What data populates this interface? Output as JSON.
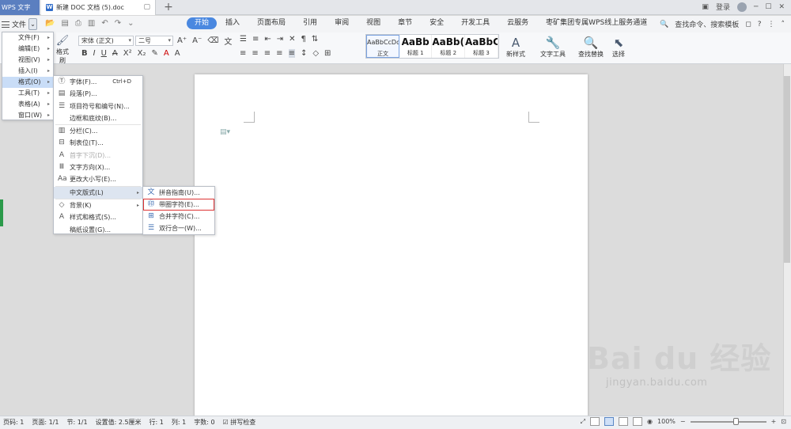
{
  "titlebar": {
    "app_tab": "WPS 文字",
    "doc_tab": "新建 DOC 文档 (5).doc",
    "login": "登录"
  },
  "menubar": {
    "file": "文件",
    "tabs": [
      "开始",
      "插入",
      "页面布局",
      "引用",
      "审阅",
      "视图",
      "章节",
      "安全",
      "开发工具",
      "云服务",
      "枣矿集团专属WPS线上服务通道"
    ],
    "active_tab": "开始",
    "search": "查找命令、搜索模板"
  },
  "ribbon": {
    "format_painter": "格式刷",
    "font_name": "宋体 (正文)",
    "font_size": "二号",
    "styles": [
      {
        "preview": "AaBbCcDd",
        "label": "正文"
      },
      {
        "preview": "AaBb",
        "label": "标题 1"
      },
      {
        "preview": "AaBb(",
        "label": "标题 2"
      },
      {
        "preview": "AaBbC(",
        "label": "标题 3"
      }
    ],
    "new_style": "新样式",
    "text_tools": "文字工具",
    "find_replace": "查找替换",
    "select": "选择"
  },
  "file_menu": {
    "items": [
      "文件(F)",
      "编辑(E)",
      "视图(V)",
      "插入(I)",
      "格式(O)",
      "工具(T)",
      "表格(A)",
      "窗口(W)"
    ],
    "highlighted_index": 4
  },
  "format_menu": {
    "items": [
      {
        "label": "字体(F)...",
        "shortcut": "Ctrl+D",
        "icon": "font-icon"
      },
      {
        "label": "段落(P)...",
        "icon": "paragraph-icon"
      },
      {
        "label": "项目符号和编号(N)...",
        "icon": "bullets-icon"
      },
      {
        "label": "边框和底纹(B)...",
        "icon": ""
      },
      {
        "label": "分栏(C)...",
        "icon": "columns-icon"
      },
      {
        "label": "制表位(T)...",
        "icon": "tabstop-icon"
      },
      {
        "label": "首字下沉(D)...",
        "icon": "dropcap-icon",
        "disabled": true
      },
      {
        "label": "文字方向(X)...",
        "icon": "text-direction-icon"
      },
      {
        "label": "更改大小写(E)...",
        "icon": "change-case-icon"
      },
      {
        "label": "中文版式(L)",
        "icon": "",
        "submenu": true,
        "highlighted": true
      },
      {
        "label": "背景(K)",
        "icon": "background-icon",
        "submenu": true
      },
      {
        "label": "样式和格式(S)...",
        "icon": "styles-icon"
      },
      {
        "label": "稿纸设置(G)...",
        "icon": ""
      }
    ]
  },
  "chinese_layout_menu": {
    "items": [
      {
        "label": "拼音指南(U)...",
        "icon": "pinyin-icon"
      },
      {
        "label": "带圈字符(E)...",
        "icon": "enclosed-char-icon",
        "selected": true
      },
      {
        "label": "合并字符(C)...",
        "icon": "combine-char-icon"
      },
      {
        "label": "双行合一(W)...",
        "icon": "two-lines-icon"
      }
    ]
  },
  "statusbar": {
    "page": "页码: 1",
    "pages": "页面: 1/1",
    "section": "节: 1/1",
    "position": "设置值: 2.5厘米",
    "row": "行: 1",
    "col": "列: 1",
    "words": "字数: 0",
    "spell": "拼写检查",
    "zoom": "100%"
  },
  "watermark": {
    "brand": "Bai du 经验",
    "url": "jingyan.baidu.com"
  }
}
